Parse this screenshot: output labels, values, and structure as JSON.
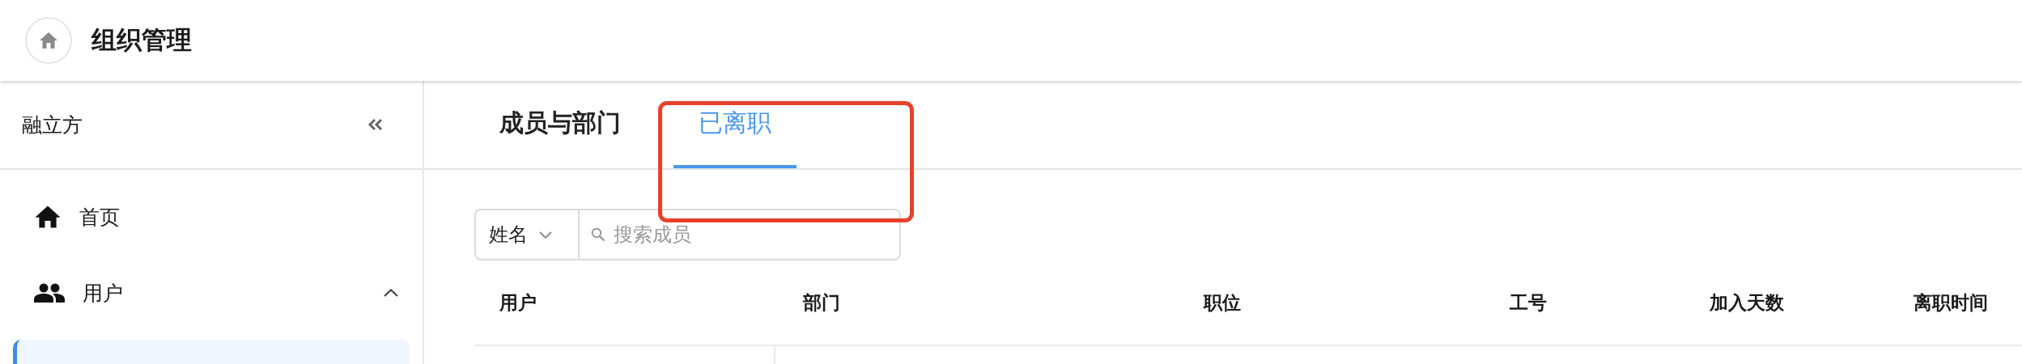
{
  "header": {
    "title": "组织管理"
  },
  "sidebar": {
    "org_name": "融立方",
    "items": [
      {
        "label": "首页",
        "kind": "home",
        "selected": false
      },
      {
        "label": "用户",
        "kind": "users",
        "expanded": true,
        "selected": false,
        "children": [
          {
            "selected": true
          }
        ]
      }
    ]
  },
  "tabs": [
    {
      "label": "成员与部门",
      "selected": false
    },
    {
      "label": "已离职",
      "selected": true
    }
  ],
  "search": {
    "field_select": "姓名",
    "placeholder": "搜索成员"
  },
  "table": {
    "columns": [
      "用户",
      "部门",
      "职位",
      "工号",
      "加入天数",
      "离职时间"
    ]
  },
  "annotation": {
    "kind": "highlight-frame"
  }
}
